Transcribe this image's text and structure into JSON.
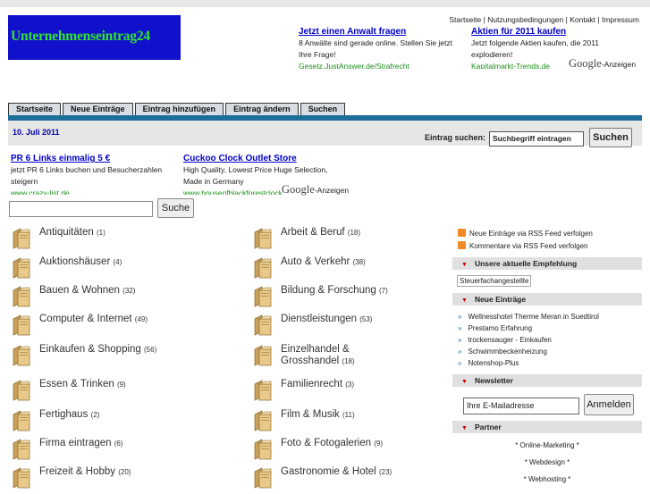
{
  "logo": "Unternehmenseintrag24",
  "top_links": "Startseite | Nutzungsbedingungen | Kontakt | Impressum",
  "header_ads": [
    {
      "title": "Jetzt einen Anwalt fragen",
      "text": "8 Anwälte sind gerade online. Stellen Sie jetzt Ihre Frage!",
      "url": "Gesetz.JustAnswer.de/Strafrecht"
    },
    {
      "title": "Aktien für 2011 kaufen",
      "text": "Jetzt folgende Aktien kaufen, die 2011 explodieren!",
      "url": "Kapitalmarkt-Trends.de"
    }
  ],
  "google_ads_label": "-Anzeigen",
  "google_word": "Google",
  "nav": [
    "Startseite",
    "Neue Einträge",
    "Eintrag hinzufügen",
    "Eintrag ändern",
    "Suchen"
  ],
  "date": "10. Juli 2011",
  "search": {
    "label": "Eintrag suchen:",
    "value": "Suchbegriff eintragen",
    "button": "Suchen"
  },
  "content_ads": [
    {
      "title": "PR 6 Links einmalig 5 €",
      "text": "jetzt PR 6 Links buchen und Besucherzahlen steigern",
      "url": "www.crazy-list.de"
    },
    {
      "title": "Cuckoo Clock Outlet Store",
      "text": "High Quality, Lowest Price Huge Selection, Made in Germany",
      "url": "www.houseofblackforestclocks.com"
    }
  ],
  "small_search_button": "Suche",
  "categories_left": [
    {
      "name": "Antiquitäten",
      "count": "(1)"
    },
    {
      "name": "Auktionshäuser",
      "count": "(4)"
    },
    {
      "name": "Bauen & Wohnen",
      "count": "(32)"
    },
    {
      "name": "Computer & Internet",
      "count": "(49)"
    },
    {
      "name": "Einkaufen & Shopping",
      "count": "(56)"
    },
    {
      "name": "Essen & Trinken",
      "count": "(9)"
    },
    {
      "name": "Fertighaus",
      "count": "(2)"
    },
    {
      "name": "Firma eintragen",
      "count": "(6)"
    },
    {
      "name": "Freizeit & Hobby",
      "count": "(20)"
    }
  ],
  "categories_right": [
    {
      "name": "Arbeit & Beruf",
      "count": "(18)"
    },
    {
      "name": "Auto & Verkehr",
      "count": "(38)"
    },
    {
      "name": "Bildung & Forschung",
      "count": "(7)"
    },
    {
      "name": "Dienstleistungen",
      "count": "(53)"
    },
    {
      "name": "Einzelhandel & Grosshandel",
      "count": "(18)"
    },
    {
      "name": "Familienrecht",
      "count": "(3)"
    },
    {
      "name": "Film & Musik",
      "count": "(11)"
    },
    {
      "name": "Foto & Fotogalerien",
      "count": "(9)"
    },
    {
      "name": "Gastronomie & Hotel",
      "count": "(23)"
    }
  ],
  "sidebar": {
    "rss1": "Neue Einträge via RSS Feed verfolgen",
    "rss2": "Kommentare via RSS Feed verfolgen",
    "empfehlung_title": "Unsere aktuelle Empfehlung",
    "empfehlung_link": "Steuerfachangestellte",
    "neue_title": "Neue Einträge",
    "neue": [
      "Wellnesshotel Therme Meran in Suedtirol",
      "Prestamo Erfahrung",
      "trockensauger  - Einkaufen",
      "Schwimmbeckenheizung",
      "Notenshop-Plus"
    ],
    "newsletter_title": "Newsletter",
    "newsletter_placeholder": "Ihre E-Mailadresse",
    "newsletter_button": "Anmelden",
    "partner_title": "Partner",
    "partners": [
      "* Online-Marketing *",
      "* Webdesign *",
      "* Webhosting *"
    ]
  }
}
